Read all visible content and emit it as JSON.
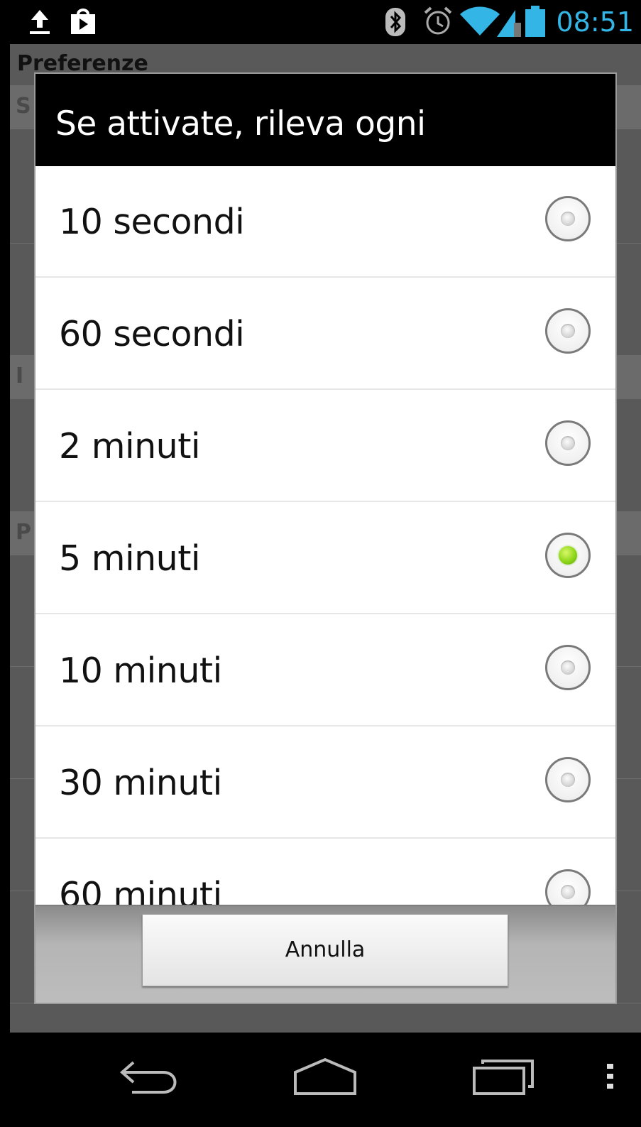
{
  "status_bar": {
    "time": "08:51",
    "clock_color": "#33b5e5",
    "icons": [
      "upload-icon",
      "store-icon",
      "bluetooth-icon",
      "alarm-icon",
      "wifi-icon",
      "signal-icon",
      "battery-icon"
    ]
  },
  "background_screen": {
    "title": "Preferenze"
  },
  "dialog": {
    "title": "Se attivate, rileva ogni",
    "options": [
      {
        "label": "10 secondi",
        "selected": false
      },
      {
        "label": "60 secondi",
        "selected": false
      },
      {
        "label": "2 minuti",
        "selected": false
      },
      {
        "label": "5 minuti",
        "selected": true
      },
      {
        "label": "10 minuti",
        "selected": false
      },
      {
        "label": "30 minuti",
        "selected": false
      },
      {
        "label": "60 minuti",
        "selected": false
      }
    ],
    "cancel_label": "Annulla",
    "selected_color": "#8fd61a"
  },
  "nav_bar": {
    "buttons": [
      "back-icon",
      "home-icon",
      "recent-apps-icon",
      "menu-overflow-icon"
    ]
  }
}
